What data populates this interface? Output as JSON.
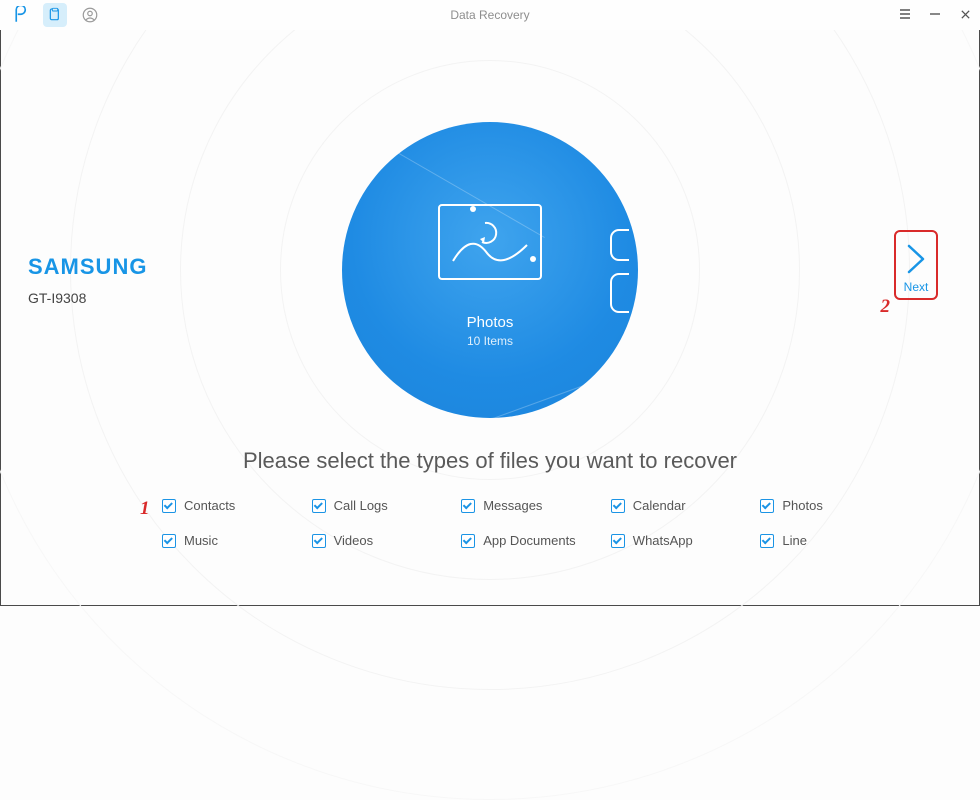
{
  "header": {
    "title": "Data Recovery"
  },
  "device": {
    "brand": "SAMSUNG",
    "model": "GT-I9308"
  },
  "center": {
    "caption": "Photos",
    "subcaption": "10 Items"
  },
  "next": {
    "label": "Next"
  },
  "instruction": "Please select the types of files you want to recover",
  "annotations": {
    "step1": "1",
    "step2": "2"
  },
  "types": [
    {
      "label": "Contacts",
      "checked": true
    },
    {
      "label": "Call Logs",
      "checked": true
    },
    {
      "label": "Messages",
      "checked": true
    },
    {
      "label": "Calendar",
      "checked": true
    },
    {
      "label": "Photos",
      "checked": true
    },
    {
      "label": "Music",
      "checked": true
    },
    {
      "label": "Videos",
      "checked": true
    },
    {
      "label": "App Documents",
      "checked": true
    },
    {
      "label": "WhatsApp",
      "checked": true
    },
    {
      "label": "Line",
      "checked": true
    }
  ],
  "colors": {
    "accent": "#1895e6",
    "annotation": "#d92a2a"
  }
}
